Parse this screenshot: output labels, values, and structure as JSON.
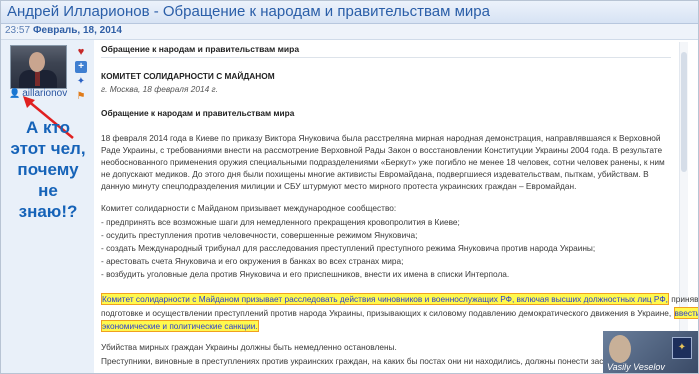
{
  "window": {
    "title": "Андрей Илларионов - Обращение к народам и правительствам мира"
  },
  "meta": {
    "time": "23:57",
    "date": "Февраль, 18, 2014"
  },
  "sidebar": {
    "username": "aillarionov"
  },
  "annotation": {
    "text": "А кто\nэтот чел,\nпочему\nне\nзнаю!?"
  },
  "post": {
    "title": "Обращение к народам и правительствам мира",
    "org": "КОМИТЕТ СОЛИДАРНОСТИ С МАЙДАНОМ",
    "place_date": "г. Москва, 18 февраля 2014 г.",
    "heading": "Обращение к народам и правительствам мира",
    "para1": "18 февраля 2014 года в Киеве по приказу Виктора Януковича была расстреляна мирная народная демонстрация, направлявшаяся к Верховной Раде Украины, с требованиями внести на рассмотрение Верховной Рады Закон о восстановлении Конституции Украины 2004 года. В результате необоснованного применения оружия специальными подразделениями «Беркут» уже погибло не менее 18 человек, сотни человек ранены, к ним не допускают медиков. До этого дня были похищены многие активисты Евромайдана, подвергшиеся издевательствам, пыткам, убийствам. В данную минуту спецподразделения милиции и СБУ штурмуют место мирного протеста украинских граждан – Евромайдан.",
    "appeal": "Комитет солидарности с Майданом призывает международное сообщество:",
    "bullets": [
      "- предпринять все возможные шаги для немедленного прекращения кровопролития в Киеве;",
      "- осудить преступления против человечности, совершенные режимом Януковича;",
      "- создать Международный трибунал для расследования преступлений преступного режима Януковича против народа Украины;",
      "- арестовать счета Януковича и его окружения в банках во всех странах мира;",
      "- возбудить уголовные дела против Януковича и его приспешников, внести их имена в списки Интерпола."
    ],
    "hl1": "Комитет солидарности с Майданом призывает расследовать действия чиновников и военнослужащих РФ, включая высших должностных лиц РФ,",
    "after_hl1": " принявших участие в",
    "line2": "подготовке и осуществлении преступлений против народа Украины, призывающих к силовому подавлению демократического движения в Украине,",
    "hl2a": "ввести против них",
    "hl2b": "экономические и политические санкции.",
    "para3a": "Убийства мирных граждан Украины должны быть немедленно остановлены.",
    "para3b": "Преступники, виновные в преступлениях против украинских граждан, на каких бы постах они ни находились, должны понести заслуженное наказание."
  },
  "watermark": {
    "signature": "Vasily Veselov"
  },
  "colors": {
    "title": "#2a5ea8",
    "annotation": "#1663b8",
    "highlight": "#fff94d"
  }
}
